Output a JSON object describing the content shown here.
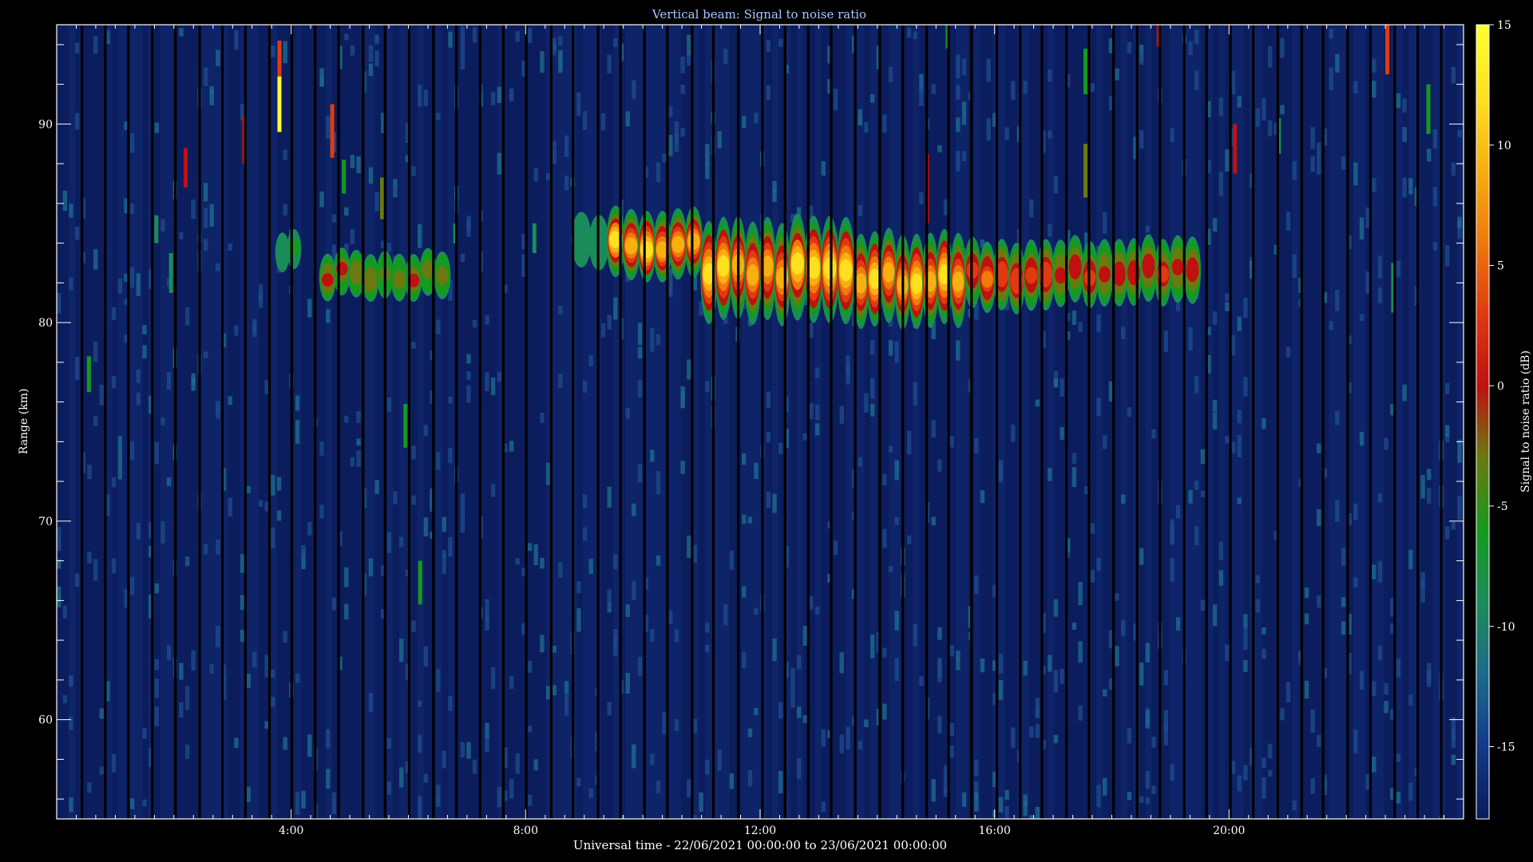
{
  "chart_data": {
    "type": "heatmap",
    "title": "Vertical beam: Signal to noise ratio",
    "xlabel": "Universal time - 22/06/2021 00:00:00 to 23/06/2021 00:00:00",
    "ylabel": "Range (km)",
    "colorbar_label": "Signal to noise ratio (dB)",
    "x_unit": "hours UT",
    "xlim": [
      0,
      24
    ],
    "ylim": [
      55,
      95
    ],
    "color_range": [
      -18,
      15
    ],
    "x_major_ticks": [
      4,
      8,
      12,
      16,
      20
    ],
    "x_tick_labels": [
      "4:00",
      "8:00",
      "12:00",
      "16:00",
      "20:00"
    ],
    "y_major_ticks": [
      60,
      70,
      80,
      90
    ],
    "y_tick_labels": [
      "60",
      "70",
      "80",
      "90"
    ],
    "colorbar_ticks": [
      15,
      10,
      5,
      0,
      -5,
      -10,
      -15
    ],
    "colorbar_tick_labels": [
      "15",
      "10",
      "5",
      "0",
      "-5",
      "-10",
      "-15"
    ],
    "colormap": [
      "#0b1a5a",
      "#123a8a",
      "#1d6a8c",
      "#1a8c5a",
      "#149a1e",
      "#6a7a10",
      "#c01010",
      "#e03a10",
      "#f07a0a",
      "#f8b010",
      "#ffe020",
      "#ffff30"
    ],
    "background_snr_db": -15,
    "echo_layers": [
      {
        "time_start": 3.75,
        "time_end": 4.15,
        "range_center": 83.6,
        "range_thickness": 1.6,
        "peak_snr_db": -6
      },
      {
        "time_start": 4.5,
        "time_end": 6.7,
        "range_center": 82.4,
        "range_thickness": 2.0,
        "peak_snr_db": 0
      },
      {
        "time_start": 8.8,
        "time_end": 9.4,
        "range_center": 84.2,
        "range_thickness": 2.4,
        "peak_snr_db": -6
      },
      {
        "time_start": 9.4,
        "time_end": 11.0,
        "range_center": 84.0,
        "range_thickness": 3.2,
        "peak_snr_db": 12
      },
      {
        "time_start": 11.0,
        "time_end": 12.5,
        "range_center": 82.6,
        "range_thickness": 4.8,
        "peak_snr_db": 12
      },
      {
        "time_start": 12.5,
        "time_end": 13.6,
        "range_center": 82.6,
        "range_thickness": 5.0,
        "peak_snr_db": 14
      },
      {
        "time_start": 13.6,
        "time_end": 15.5,
        "range_center": 82.2,
        "range_thickness": 4.4,
        "peak_snr_db": 13
      },
      {
        "time_start": 15.5,
        "time_end": 17.0,
        "range_center": 82.4,
        "range_thickness": 3.2,
        "peak_snr_db": 6
      },
      {
        "time_start": 17.0,
        "time_end": 19.5,
        "range_center": 82.6,
        "range_thickness": 3.0,
        "peak_snr_db": 3
      }
    ],
    "isolated_echoes": [
      {
        "time": 0.55,
        "range_from": 76.5,
        "range_to": 78.3,
        "snr_db": -7
      },
      {
        "time": 1.7,
        "range_from": 84.0,
        "range_to": 85.4,
        "snr_db": -8
      },
      {
        "time": 1.95,
        "range_from": 81.5,
        "range_to": 83.5,
        "snr_db": -8
      },
      {
        "time": 2.2,
        "range_from": 86.8,
        "range_to": 88.8,
        "snr_db": 0
      },
      {
        "time": 3.2,
        "range_from": 88.0,
        "range_to": 90.4,
        "snr_db": 1
      },
      {
        "time": 3.8,
        "range_from": 89.6,
        "range_to": 92.4,
        "snr_db": 14
      },
      {
        "time": 3.8,
        "range_from": 92.4,
        "range_to": 94.2,
        "snr_db": 2
      },
      {
        "time": 4.7,
        "range_from": 88.3,
        "range_to": 91.0,
        "snr_db": 2
      },
      {
        "time": 4.9,
        "range_from": 86.5,
        "range_to": 88.2,
        "snr_db": -7
      },
      {
        "time": 5.55,
        "range_from": 85.2,
        "range_to": 87.3,
        "snr_db": -2
      },
      {
        "time": 5.95,
        "range_from": 73.7,
        "range_to": 75.9,
        "snr_db": -7
      },
      {
        "time": 6.2,
        "range_from": 65.8,
        "range_to": 68.0,
        "snr_db": -6
      },
      {
        "time": 6.8,
        "range_from": 84.0,
        "range_to": 85.0,
        "snr_db": -9
      },
      {
        "time": 8.15,
        "range_from": 83.5,
        "range_to": 85.0,
        "snr_db": -9
      },
      {
        "time": 14.85,
        "range_from": 85.0,
        "range_to": 88.5,
        "snr_db": 0
      },
      {
        "time": 15.2,
        "range_from": 93.8,
        "range_to": 95.0,
        "snr_db": -5
      },
      {
        "time": 17.55,
        "range_from": 86.3,
        "range_to": 89.0,
        "snr_db": -3
      },
      {
        "time": 17.55,
        "range_from": 91.5,
        "range_to": 93.8,
        "snr_db": -7
      },
      {
        "time": 18.8,
        "range_from": 93.9,
        "range_to": 95.0,
        "snr_db": 1
      },
      {
        "time": 20.1,
        "range_from": 87.5,
        "range_to": 90.0,
        "snr_db": 1
      },
      {
        "time": 20.85,
        "range_from": 88.5,
        "range_to": 90.3,
        "snr_db": -9
      },
      {
        "time": 22.7,
        "range_from": 92.5,
        "range_to": 95.0,
        "snr_db": 4
      },
      {
        "time": 22.8,
        "range_from": 80.5,
        "range_to": 83.0,
        "snr_db": -8
      },
      {
        "time": 23.4,
        "range_from": 89.5,
        "range_to": 92.0,
        "snr_db": -7
      }
    ]
  }
}
